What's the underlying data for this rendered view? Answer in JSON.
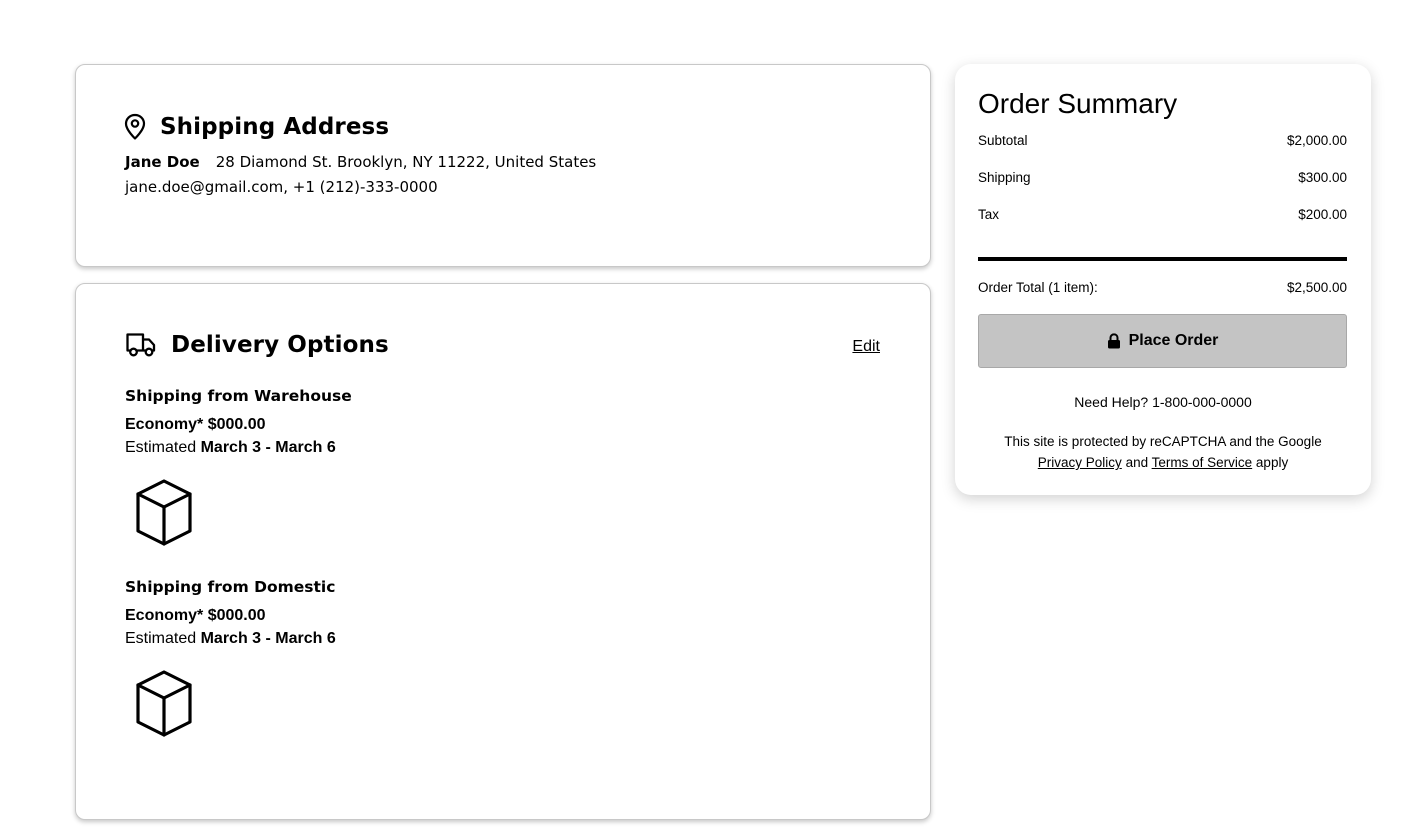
{
  "shipping_address": {
    "title": "Shipping Address",
    "name": "Jane Doe",
    "address": "28 Diamond St. Brooklyn, NY 11222, United States",
    "contact": "jane.doe@gmail.com, +1 (212)-333-0000",
    "icon": "map-pin-icon"
  },
  "delivery": {
    "title": "Delivery Options",
    "edit_label": "Edit",
    "icon": "truck-icon",
    "groups": [
      {
        "title": "Shipping from Warehouse",
        "method": "Economy*",
        "price": "$000.00",
        "estimated_label": "Estimated",
        "estimated_dates": "March 3 - March 6",
        "icon": "package-box-icon"
      },
      {
        "title": "Shipping from Domestic",
        "method": "Economy*",
        "price": "$000.00",
        "estimated_label": "Estimated",
        "estimated_dates": "March 3 - March 6",
        "icon": "package-box-icon"
      }
    ]
  },
  "summary": {
    "title": "Order Summary",
    "rows": [
      {
        "label": "Subtotal",
        "value": "$2,000.00"
      },
      {
        "label": "Shipping",
        "value": "$300.00"
      },
      {
        "label": "Tax",
        "value": "$200.00"
      }
    ],
    "total_label": "Order Total (1 item):",
    "total_value": "$2,500.00",
    "place_order_label": "Place Order",
    "place_order_icon": "lock-icon",
    "help_text": "Need Help? 1-800-000-0000",
    "recaptcha_text": "This site is protected by reCAPTCHA and the Google",
    "privacy_label": "Privacy Policy",
    "and_text": "and",
    "terms_label": "Terms of Service",
    "apply_text": "apply"
  },
  "colors": {
    "button_bg": "#c4c4c4",
    "text": "#000000",
    "card_border": "#c8c8c8"
  }
}
